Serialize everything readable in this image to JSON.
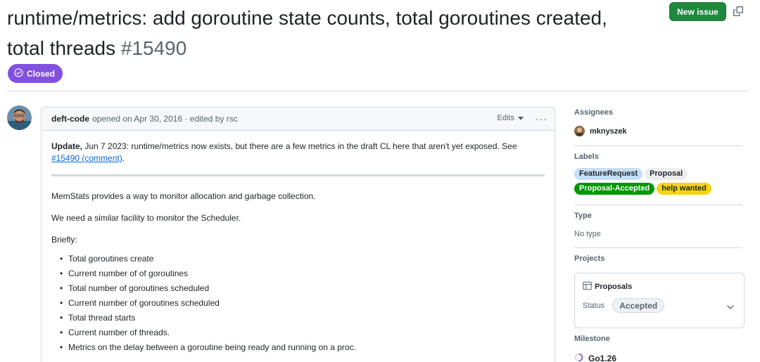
{
  "issue": {
    "title": "runtime/metrics: add goroutine state counts, total goroutines created, total threads",
    "number": "#15490",
    "state": "Closed"
  },
  "header": {
    "new_issue_label": "New issue"
  },
  "comment": {
    "author": "deft-code",
    "meta": "opened on Apr 30, 2016 · edited by rsc",
    "edits_label": "Edits",
    "more_label": "···",
    "update_bold": "Update,",
    "update_text": " Jun 7 2023: runtime/metrics now exists, but there are a few metrics in the draft CL here that aren't yet exposed. See ",
    "update_link": "#15490 (comment)",
    "update_end": ".",
    "paragraphs": [
      "MemStats provides a way to monitor allocation and garbage collection.",
      "We need a similar facility to monitor the Scheduler.",
      "Briefly:"
    ],
    "bullets": [
      "Total goroutines create",
      "Current number of of goroutines",
      "Total number of goroutines scheduled",
      "Current number of goroutines scheduled",
      "Total thread starts",
      "Current number of threads.",
      "Metrics on the delay between a goroutine being ready and running on a proc."
    ]
  },
  "sidebar": {
    "assignees": {
      "heading": "Assignees",
      "user": "mknyszek"
    },
    "labels": {
      "heading": "Labels",
      "items": [
        {
          "name": "FeatureRequest",
          "bg": "#c5def5",
          "fg": "#1f2328"
        },
        {
          "name": "Proposal",
          "bg": "#ededed",
          "fg": "#1f2328"
        },
        {
          "name": "Proposal-Accepted",
          "bg": "#009800",
          "fg": "#ffffff"
        },
        {
          "name": "help wanted",
          "bg": "#f4d40d",
          "fg": "#1f2328"
        }
      ]
    },
    "type": {
      "heading": "Type",
      "value": "No type"
    },
    "projects": {
      "heading": "Projects",
      "name": "Proposals",
      "status_label": "Status",
      "status_value": "Accepted"
    },
    "milestone": {
      "heading": "Milestone",
      "value": "Go1.26"
    }
  },
  "colors": {
    "closed": "#8250df",
    "new_issue": "#1f883d",
    "link": "#0969da"
  }
}
